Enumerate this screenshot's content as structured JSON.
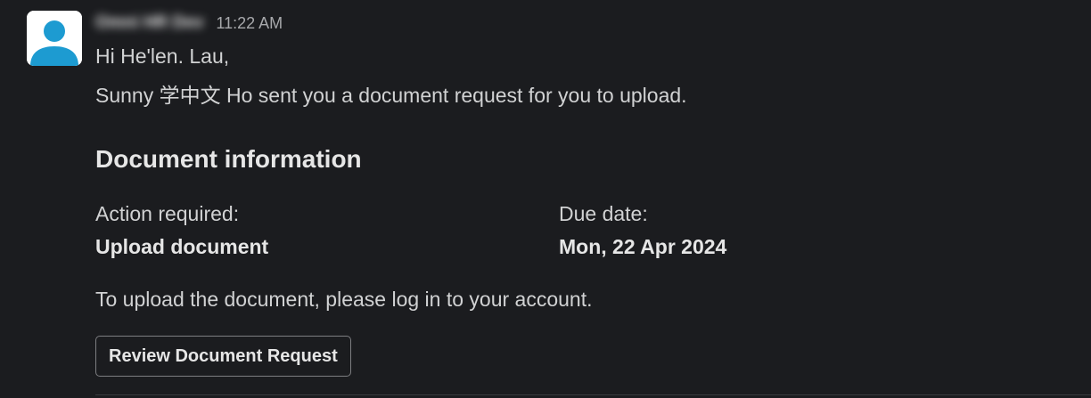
{
  "message": {
    "sender_name": "Omni HR Dev",
    "timestamp": "11:22 AM",
    "avatar_icon": "user-silhouette-icon",
    "avatar_color": "#1d9bd1",
    "greeting": "Hi He'len. Lau,",
    "intro": "Sunny 学中文 Ho sent you a document request for you to upload.",
    "section_title": "Document information",
    "fields": [
      {
        "label": "Action required:",
        "value": "Upload document"
      },
      {
        "label": "Due date:",
        "value": "Mon, 22 Apr 2024"
      }
    ],
    "instruction": "To upload the document, please log in to your account.",
    "button_label": "Review Document Request"
  }
}
